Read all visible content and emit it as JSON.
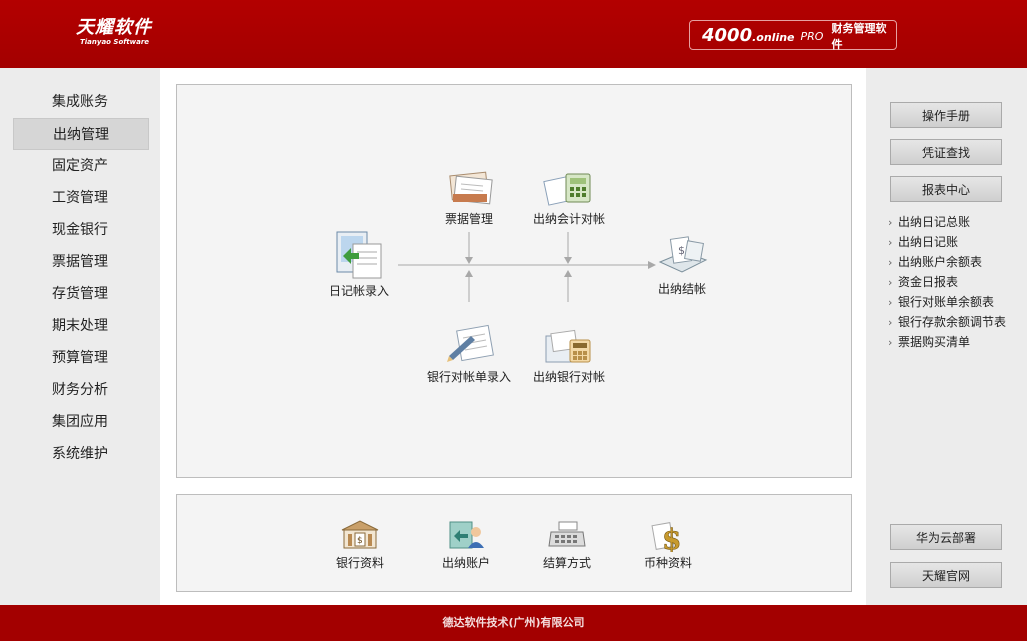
{
  "header": {
    "logo_cn": "天耀软件",
    "logo_en": "Tianyao Software",
    "product_num": "4000",
    "product_online": ".online",
    "product_pro": "PRO",
    "product_name": "财务管理软件"
  },
  "sidebar": {
    "items": [
      {
        "label": "集成账务"
      },
      {
        "label": "出纳管理",
        "active": true
      },
      {
        "label": "固定资产"
      },
      {
        "label": "工资管理"
      },
      {
        "label": "现金银行"
      },
      {
        "label": "票据管理"
      },
      {
        "label": "存货管理"
      },
      {
        "label": "期末处理"
      },
      {
        "label": "预算管理"
      },
      {
        "label": "财务分析"
      },
      {
        "label": "集团应用"
      },
      {
        "label": "系统维护"
      }
    ]
  },
  "flow": {
    "diary_entry": "日记帐录入",
    "bill_mgmt": "票据管理",
    "reconcile_accounting": "出纳会计对帐",
    "closing": "出纳结帐",
    "bank_statement_entry": "银行对帐单录入",
    "reconcile_bank": "出纳银行对帐"
  },
  "basics": {
    "bank_info": "银行资料",
    "cashier_account": "出纳账户",
    "settlement": "结算方式",
    "currency": "币种资料"
  },
  "right": {
    "manual": "操作手册",
    "voucher_search": "凭证查找",
    "report_center": "报表中心",
    "links": [
      "出纳日记总账",
      "出纳日记账",
      "出纳账户余额表",
      "资金日报表",
      "银行对账单余额表",
      "银行存款余额调节表",
      "票据购买清单"
    ],
    "huawei": "华为云部署",
    "official": "天耀官网"
  },
  "footer": {
    "company": "德达软件技术(广州)有限公司"
  },
  "colors": {
    "brand_red": "#a30000",
    "panel_bg": "#f4f4f4",
    "sidebar_bg": "#ececec"
  }
}
